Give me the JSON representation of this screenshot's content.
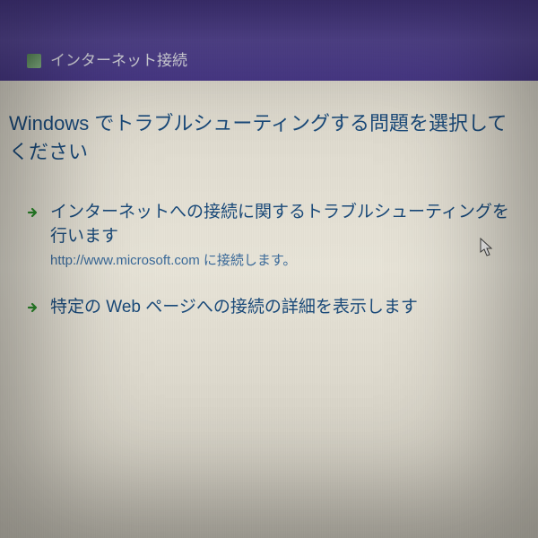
{
  "titlebar": {
    "title": "インターネット接続"
  },
  "heading": "Windows でトラブルシューティングする問題を選択してください",
  "options": [
    {
      "title": "インターネットへの接続に関するトラブルシューティングを行います",
      "sub": "http://www.microsoft.com に接続します。"
    },
    {
      "title": "特定の Web ページへの接続の詳細を表示します",
      "sub": ""
    }
  ],
  "colors": {
    "titlebar": "#4a3a8a",
    "heading": "#1a4a7a",
    "link": "#1a4a7a",
    "arrow": "#2a8a2a"
  }
}
